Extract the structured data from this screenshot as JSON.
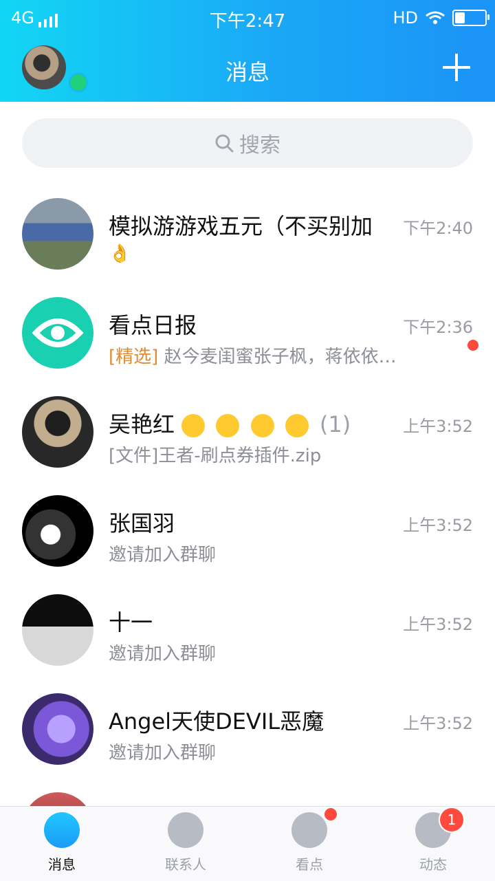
{
  "status_bar": {
    "network": "4G",
    "time": "下午2:47",
    "hd": "HD"
  },
  "header": {
    "title": "消息"
  },
  "search": {
    "placeholder": "搜索"
  },
  "conversations": [
    {
      "name": "模拟游游戏五元（不买别加",
      "subtitle": "👌",
      "time": "下午2:40"
    },
    {
      "name": "看点日报",
      "tag": "[精选]",
      "subtitle": "赵今麦闺蜜张子枫，蒋依依…",
      "time": "下午2:36",
      "has_unread_dot": true
    },
    {
      "name": "吴艳红",
      "count": "(1)",
      "subtitle": "[文件]王者-刷点券插件.zip",
      "time": "上午3:52"
    },
    {
      "name": "张国羽",
      "subtitle": "邀请加入群聊",
      "time": "上午3:52"
    },
    {
      "name": "十一",
      "subtitle": "邀请加入群聊",
      "time": "上午3:52"
    },
    {
      "name": "Angel天使DEVIL恶魔",
      "subtitle": "邀请加入群聊",
      "time": "上午3:52"
    }
  ],
  "tabbar": {
    "items": [
      {
        "label": "消息",
        "active": true
      },
      {
        "label": "联系人"
      },
      {
        "label": "看点",
        "dot": true
      },
      {
        "label": "动态",
        "badge": "1"
      }
    ]
  },
  "colors": {
    "header_start": "#12d6f4",
    "header_end": "#1b93f7",
    "tag_orange": "#e18a2f",
    "unread_red": "#ff4a3d"
  }
}
